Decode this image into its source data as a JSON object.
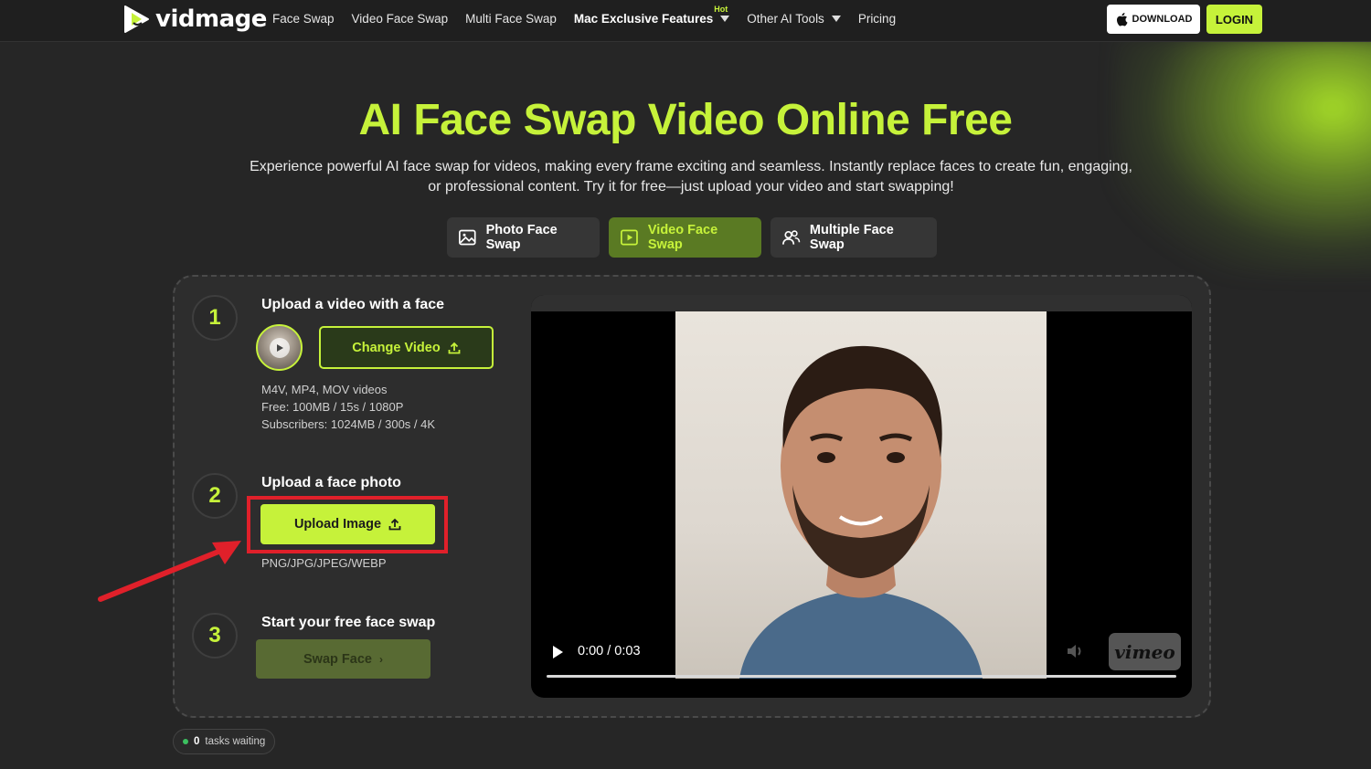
{
  "nav": {
    "logo_text": "vidmage",
    "links": [
      {
        "label": "Face Swap"
      },
      {
        "label": "Video Face Swap"
      },
      {
        "label": "Multi Face Swap"
      },
      {
        "label": "Mac Exclusive Features",
        "badge": "Hot"
      },
      {
        "label": "Other AI Tools"
      },
      {
        "label": "Pricing"
      }
    ],
    "download_label": "DOWNLOAD",
    "login_label": "LOGIN"
  },
  "hero": {
    "title": "AI Face Swap Video Online Free",
    "subtitle_line1": "Experience powerful AI face swap for videos, making every frame exciting and seamless. Instantly replace faces to create fun, engaging,",
    "subtitle_line2": "or professional content. Try it for free—just upload your video and start swapping!"
  },
  "mode_tabs": [
    {
      "label": "Photo Face Swap",
      "icon": "image-icon",
      "active": false
    },
    {
      "label": "Video Face Swap",
      "icon": "video-play-icon",
      "active": true
    },
    {
      "label": "Multiple Face Swap",
      "icon": "users-icon",
      "active": false
    }
  ],
  "steps": {
    "step1": {
      "number": "1",
      "title": "Upload a video with a face",
      "button": "Change Video",
      "info": [
        "M4V, MP4, MOV videos",
        "Free: 100MB / 15s / 1080P",
        "Subscribers: 1024MB / 300s / 4K"
      ]
    },
    "step2": {
      "number": "2",
      "title": "Upload a face photo",
      "button": "Upload Image",
      "formats": "PNG/JPG/JPEG/WEBP"
    },
    "step3": {
      "number": "3",
      "title": "Start your free face swap",
      "button": "Swap Face"
    }
  },
  "video": {
    "time": "0:00 / 0:03",
    "brand": "vimeo",
    "progress": 0
  },
  "status": {
    "count": "0",
    "label": "tasks waiting"
  },
  "colors": {
    "accent": "#c6f23a",
    "background": "#262626",
    "highlight": "#e0202a"
  }
}
